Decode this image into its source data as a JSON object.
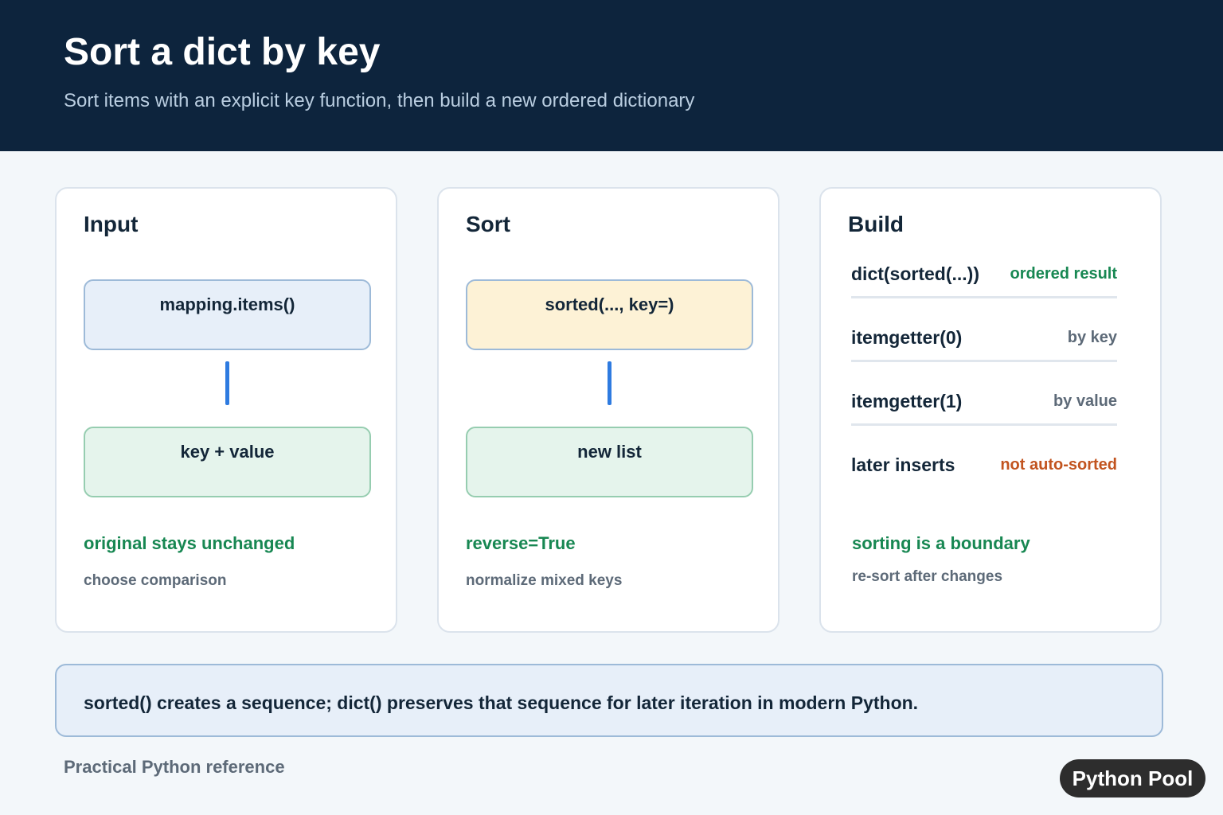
{
  "header": {
    "title": "Sort a dict by key",
    "subtitle": "Sort items with an explicit key function, then build a new ordered dictionary"
  },
  "cards": {
    "input": {
      "title": "Input",
      "top_box": "mapping.items()",
      "bottom_box": "key + value",
      "note_primary": "original stays unchanged",
      "note_secondary": "choose comparison"
    },
    "sort": {
      "title": "Sort",
      "top_box": "sorted(..., key=)",
      "bottom_box": "new list",
      "note_primary": "reverse=True",
      "note_secondary": "normalize mixed keys"
    },
    "build": {
      "title": "Build",
      "rows": [
        {
          "code": "dict(sorted(...))",
          "tag": "ordered result"
        },
        {
          "code": "itemgetter(0)",
          "tag": "by key"
        },
        {
          "code": "itemgetter(1)",
          "tag": "by value"
        },
        {
          "code": "later inserts",
          "tag": "not auto-sorted"
        }
      ],
      "note_primary": "sorting is a boundary",
      "note_secondary": "re-sort after changes"
    }
  },
  "callout": {
    "text": "sorted() creates a sequence; dict() preserves that sequence for later iteration in modern Python."
  },
  "footer": {
    "text": "Practical Python reference",
    "brand": "Python Pool"
  },
  "colors": {
    "header_bg": "#0d243d",
    "accent_blue": "#2e7be0",
    "accent_green": "#178752",
    "accent_orange": "#c2541f"
  }
}
